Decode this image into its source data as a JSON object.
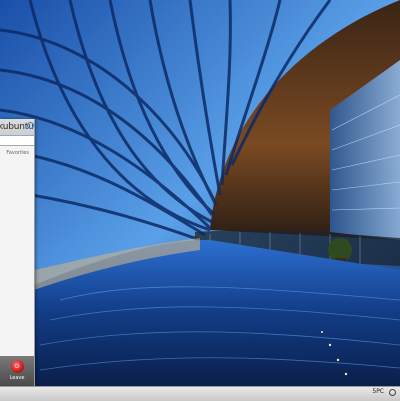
{
  "desktop": {
    "wallpaper": "national-centre-performing-arts-interior"
  },
  "kickoff": {
    "brand": "kubuntu",
    "brand_icon": "kubuntu-logo-icon",
    "search": {
      "value": "",
      "placeholder": ""
    },
    "section": "Favorites",
    "leave_label": "Leave",
    "leave_icon": "power-icon"
  },
  "panel": {
    "clock": "5PC",
    "tray_icon": "network-icon"
  },
  "colors": {
    "panel": "#d6d6d6",
    "menu": "#f4f4f4",
    "leave": "#d11a1a",
    "glass": "#2a7bd6"
  }
}
